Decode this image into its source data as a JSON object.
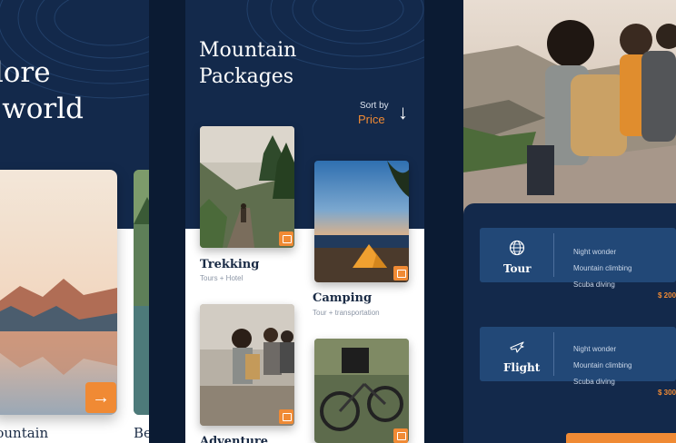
{
  "panel1": {
    "hero_line1": "plore",
    "hero_line2": "e world",
    "card1_title": "Mountain",
    "card2_title": "Be"
  },
  "panel2": {
    "title_line1": "Mountain",
    "title_line2": "Packages",
    "sort_label": "Sort by",
    "sort_value": "Price",
    "packages": [
      {
        "name": "Trekking",
        "subtitle": "Tours + Hotel"
      },
      {
        "name": "Camping",
        "subtitle": "Tour + transportation"
      },
      {
        "name": "Adventure",
        "subtitle": ""
      },
      {
        "name": "",
        "subtitle": ""
      }
    ]
  },
  "panel3": {
    "services": [
      {
        "label": "Tour",
        "icon": "globe-icon",
        "features": [
          "Night wonder",
          "Mountain climbing",
          "Scuba diving"
        ],
        "price": "$ 200"
      },
      {
        "label": "Flight",
        "icon": "airplane-icon",
        "features": [
          "Night wonder",
          "Mountain climbing",
          "Scuba diving"
        ],
        "price": "$ 300"
      }
    ]
  },
  "colors": {
    "navy": "#13294b",
    "accent": "#f08a34",
    "card_blue": "#224877"
  }
}
